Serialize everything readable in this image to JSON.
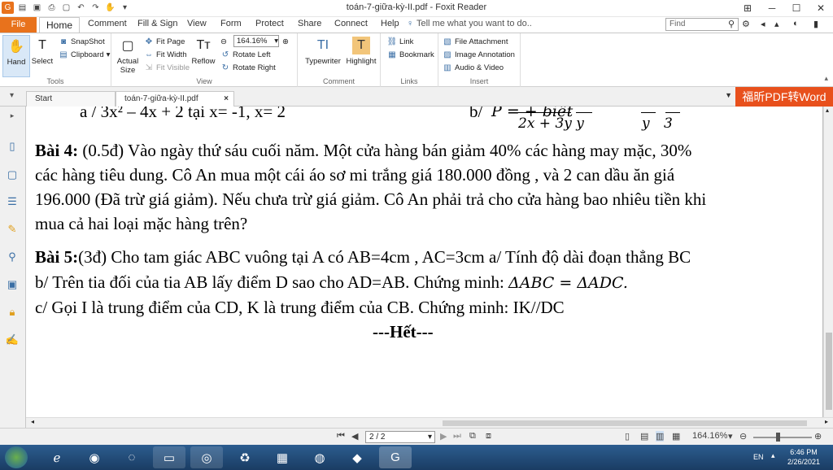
{
  "window": {
    "title": "toán-7-giữa-kỳ-II.pdf - Foxit Reader",
    "menu_tabs": [
      "File",
      "Home",
      "Comment",
      "Fill & Sign",
      "View",
      "Form",
      "Protect",
      "Share",
      "Connect",
      "Help"
    ],
    "tell_me": "Tell me what you want to do..",
    "find_placeholder": "Find"
  },
  "ribbon": {
    "tools": {
      "label": "Tools",
      "hand": "Hand",
      "select": "Select",
      "snapshot": "SnapShot",
      "clipboard": "Clipboard"
    },
    "view": {
      "label": "View",
      "actual_size": "Actual Size",
      "fit_page": "Fit Page",
      "fit_width": "Fit Width",
      "fit_visible": "Fit Visible",
      "reflow": "Reflow",
      "zoom_value": "164.16%",
      "rotate_left": "Rotate Left",
      "rotate_right": "Rotate Right"
    },
    "comment": {
      "label": "Comment",
      "typewriter": "Typewriter",
      "highlight": "Highlight"
    },
    "links": {
      "label": "Links",
      "link": "Link",
      "bookmark": "Bookmark"
    },
    "insert": {
      "label": "Insert",
      "file_attachment": "File Attachment",
      "image_annotation": "Image Annotation",
      "audio_video": "Audio & Video"
    }
  },
  "doc_tabs": {
    "start": "Start",
    "current": "toán-7-giữa-kỳ-II.pdf"
  },
  "promo": "福昕PDF转Word",
  "document": {
    "line0_left": "a / 3x² – 4x + 2   tại x= -1, x= 2",
    "line0_right_prefix": "b/",
    "line0_right_formula": "P =          +      biết",
    "line0_right_denoms": "2x + 3y     y",
    "line0_right_frac": "y   3",
    "bai4_label": "Bài 4:",
    "bai4_l1": " (0.5đ) Vào ngày thứ sáu cuối năm. Một cửa hàng bán giảm 40% các hàng may mặc, 30%",
    "bai4_l2": "các hàng tiêu dung. Cô An mua một cái áo sơ mi trắng giá 180.000 đồng , và 2 can dầu ăn giá",
    "bai4_l3": "196.000 (Đã trừ giá giảm). Nếu chưa trừ giá giảm. Cô An phải trả cho cửa hàng bao nhiêu tiền khi",
    "bai4_l4": "mua cả hai loại mặc hàng trên?",
    "bai5_label": "Bài 5:",
    "bai5_l1": "(3đ) Cho tam giác ABC vuông tại A có AB=4cm , AC=3cm    a/ Tính độ dài đoạn thẳng BC",
    "bai5_l2": "b/ Trên tia đối của tia AB lấy điểm D sao cho AD=AB. Chứng minh: ",
    "bai5_l2_math": "ΔABC = ΔADC.",
    "bai5_l3": "c/ Gọi I là trung điểm của CD, K là trung điểm của CB. Chứng minh: IK//DC",
    "end": "---Hết---"
  },
  "status": {
    "page": "2 / 2",
    "zoom": "164.16%"
  },
  "taskbar": {
    "lang": "EN",
    "time": "6:46 PM",
    "date": "2/26/2021"
  }
}
